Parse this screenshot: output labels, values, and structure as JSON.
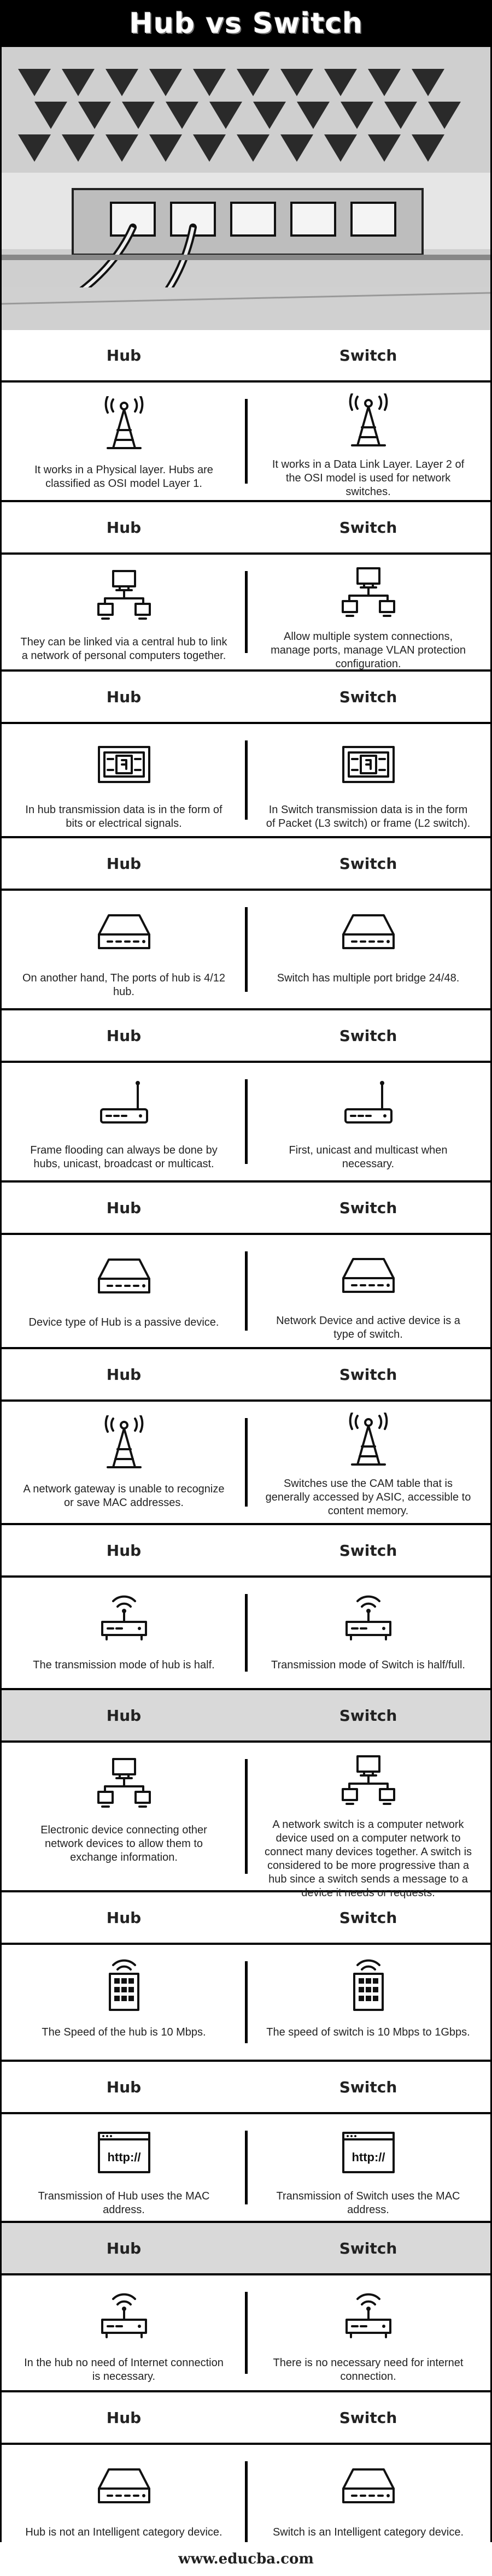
{
  "title": "Hub vs Switch",
  "hub_label": "Hub",
  "switch_label": "Switch",
  "rows": [
    {
      "hub_icon": "antenna-tower-icon",
      "switch_icon": "antenna-tower-icon",
      "hub": "It works in a Physical layer. Hubs are classified as OSI model Layer 1.",
      "switch": "It works in a Data Link Layer. Layer 2 of the OSI model is used for network switches."
    },
    {
      "hub_icon": "network-computer-icon",
      "switch_icon": "network-computer-icon",
      "hub": "They can be linked via a central hub to link a network of personal computers together.",
      "switch": "Allow multiple system connections, manage ports, manage VLAN protection configuration."
    },
    {
      "hub_icon": "data-packet-icon",
      "switch_icon": "data-packet-icon",
      "hub": "In hub transmission data is in the form of bits or electrical signals.",
      "switch": "In Switch transmission data is in the form of Packet (L3 switch) or frame (L2 switch)."
    },
    {
      "hub_icon": "network-device-icon",
      "switch_icon": "network-device-icon",
      "hub": "On another hand, The ports of hub is 4/12 hub.",
      "switch": "Switch has multiple port bridge 24/48."
    },
    {
      "hub_icon": "router-icon",
      "switch_icon": "router-icon",
      "hub": "Frame flooding can always be done by hubs, unicast, broadcast or multicast.",
      "switch": "First, unicast and multicast when necessary."
    },
    {
      "hub_icon": "network-device-icon",
      "switch_icon": "network-device-icon",
      "hub": "Device type of Hub is a passive device.",
      "switch": "Network Device and active device is a type of switch."
    },
    {
      "hub_icon": "antenna-tower-icon",
      "switch_icon": "antenna-tower-icon",
      "hub": "A network gateway is unable to recognize or save MAC addresses.",
      "switch": "Switches use the CAM table that is generally accessed by ASIC, accessible to content memory."
    },
    {
      "hub_icon": "wifi-router-icon",
      "switch_icon": "wifi-router-icon",
      "hub": "The transmission mode of hub is half.",
      "switch": "Transmission mode of Switch is half/full."
    },
    {
      "hub_icon": "network-computer-icon",
      "switch_icon": "network-computer-icon",
      "hub": "Electronic device connecting other network devices to allow them to exchange information.",
      "switch": "A network switch is a computer network device used on a computer network to connect many devices together. A switch is considered to be more progressive than a hub since a switch sends a message to a device it needs or requests."
    },
    {
      "hub_icon": "server-grid-icon",
      "switch_icon": "server-grid-icon",
      "hub": "The Speed of the hub is 10 Mbps.",
      "switch": "The speed of switch is 10 Mbps to 1Gbps."
    },
    {
      "hub_icon": "http-window-icon",
      "switch_icon": "http-window-icon",
      "hub": "Transmission of Hub uses the MAC address.",
      "switch": "Transmission of Switch uses the MAC address."
    },
    {
      "hub_icon": "wifi-router-icon",
      "switch_icon": "wifi-router-icon",
      "hub": "In the hub no need of Internet connection is necessary.",
      "switch": "There is no necessary need for internet connection."
    },
    {
      "hub_icon": "network-device-icon",
      "switch_icon": "network-device-icon",
      "hub": "Hub is not an Intelligent category device.",
      "switch": "Switch is an Intelligent category device."
    }
  ],
  "http_text": "http://",
  "footer": "www.educba.com"
}
